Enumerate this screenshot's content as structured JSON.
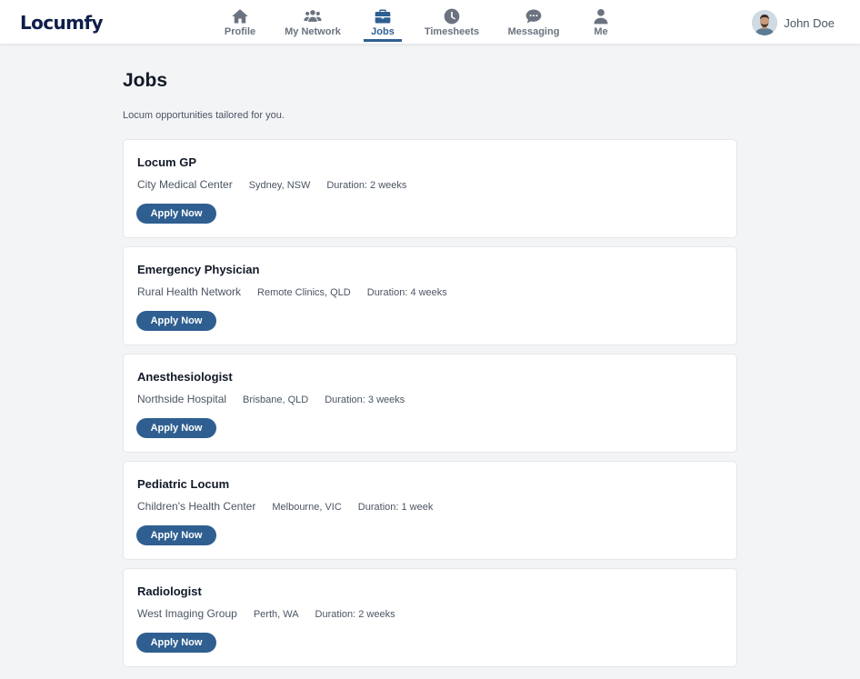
{
  "app": {
    "logo": "Locumfy"
  },
  "nav": {
    "items": [
      {
        "label": "Profile",
        "icon": "home-icon"
      },
      {
        "label": "My Network",
        "icon": "people-icon"
      },
      {
        "label": "Jobs",
        "icon": "briefcase-icon",
        "active": true
      },
      {
        "label": "Timesheets",
        "icon": "clock-icon"
      },
      {
        "label": "Messaging",
        "icon": "chat-icon"
      },
      {
        "label": "Me",
        "icon": "person-icon"
      }
    ]
  },
  "user": {
    "name": "John Doe"
  },
  "page": {
    "title": "Jobs",
    "subtitle": "Locum opportunities tailored for you."
  },
  "jobs": [
    {
      "title": "Locum GP",
      "company": "City Medical Center",
      "location": "Sydney, NSW",
      "duration": "Duration: 2 weeks",
      "apply_label": "Apply Now"
    },
    {
      "title": "Emergency Physician",
      "company": "Rural Health Network",
      "location": "Remote Clinics, QLD",
      "duration": "Duration: 4 weeks",
      "apply_label": "Apply Now"
    },
    {
      "title": "Anesthesiologist",
      "company": "Northside Hospital",
      "location": "Brisbane, QLD",
      "duration": "Duration: 3 weeks",
      "apply_label": "Apply Now"
    },
    {
      "title": "Pediatric Locum",
      "company": "Children's Health Center",
      "location": "Melbourne, VIC",
      "duration": "Duration: 1 week",
      "apply_label": "Apply Now"
    },
    {
      "title": "Radiologist",
      "company": "West Imaging Group",
      "location": "Perth, WA",
      "duration": "Duration: 2 weeks",
      "apply_label": "Apply Now"
    }
  ],
  "colors": {
    "accent": "#2f5f91",
    "logo": "#0f1e4a",
    "background": "#f3f4f6"
  }
}
